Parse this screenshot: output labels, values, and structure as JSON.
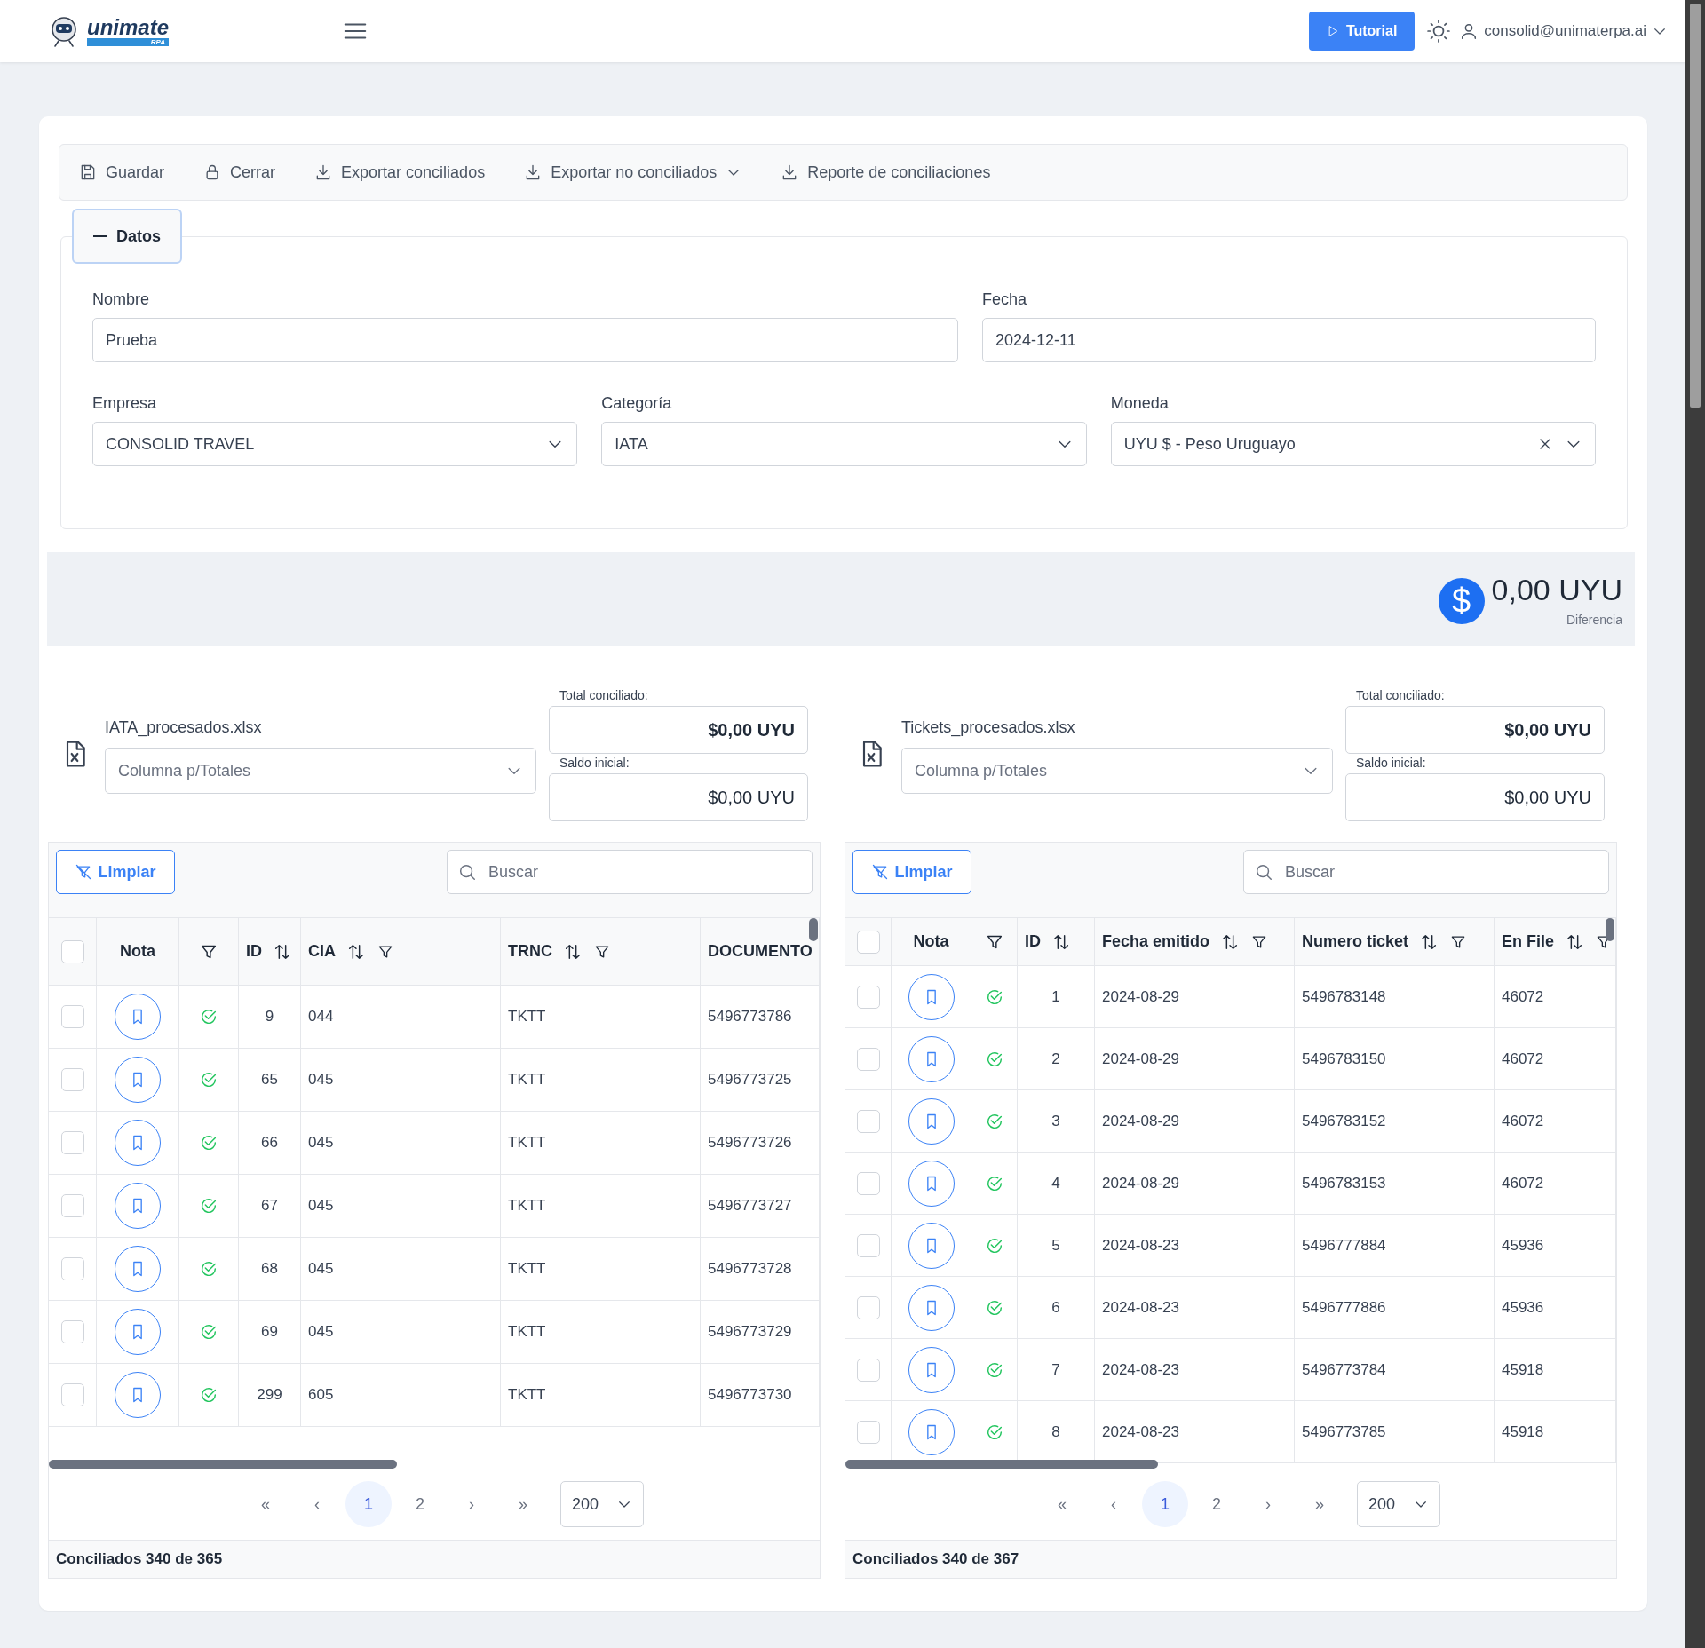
{
  "header": {
    "logo": {
      "name": "unimate",
      "tag": "RPA"
    },
    "tutorial_button": "Tutorial",
    "user": "consolid@unimaterpa.ai"
  },
  "toolbar": [
    {
      "label": "Guardar",
      "kind": "save",
      "dropdown": false
    },
    {
      "label": "Cerrar",
      "kind": "lock",
      "dropdown": false
    },
    {
      "label": "Exportar conciliados",
      "kind": "download",
      "dropdown": false
    },
    {
      "label": "Exportar no conciliados",
      "kind": "download",
      "dropdown": true
    },
    {
      "label": "Reporte de conciliaciones",
      "kind": "download",
      "dropdown": false
    }
  ],
  "datos": {
    "legend": "Datos",
    "expanded": true,
    "rows": [
      [
        {
          "label": "Nombre",
          "value": "Prueba",
          "kind": "text"
        },
        {
          "label": "Fecha",
          "value": "2024-12-11",
          "kind": "text"
        }
      ],
      [
        {
          "label": "Empresa",
          "value": "CONSOLID TRAVEL",
          "kind": "select",
          "clearable": false
        },
        {
          "label": "Categoría",
          "value": "IATA",
          "kind": "select",
          "clearable": false
        },
        {
          "label": "Moneda",
          "value": "UYU $ - Peso Uruguayo",
          "kind": "select",
          "clearable": true
        }
      ]
    ]
  },
  "difference": {
    "symbol": "$",
    "amount": "0,00 UYU",
    "label": "Diferencia"
  },
  "panels": [
    {
      "file": "IATA_procesados.xlsx",
      "column_select": {
        "placeholder": "Columna p/Totales"
      },
      "total_label": "Total conciliado:",
      "total": "$0,00 UYU",
      "saldo_label": "Saldo inicial:",
      "saldo": "$0,00 UYU",
      "clear_button": "Limpiar",
      "search": {
        "placeholder": "Buscar"
      },
      "table": {
        "columns": [
          {
            "kind": "select",
            "checked": false
          },
          {
            "kind": "label",
            "label": "Nota"
          },
          {
            "kind": "filter"
          },
          {
            "kind": "data",
            "label": "ID",
            "sortable": true,
            "filterable": false
          },
          {
            "kind": "data",
            "label": "CIA",
            "sortable": true,
            "filterable": true
          },
          {
            "kind": "data",
            "label": "TRNC",
            "sortable": true,
            "filterable": true
          },
          {
            "kind": "data",
            "label": "DOCUMENTO",
            "sortable": false,
            "filterable": false
          }
        ],
        "rows": [
          {
            "checked": false,
            "conciliado": true,
            "cells": [
              "9",
              "044",
              "TKTT",
              "5496773786"
            ]
          },
          {
            "checked": false,
            "conciliado": true,
            "cells": [
              "65",
              "045",
              "TKTT",
              "5496773725"
            ]
          },
          {
            "checked": false,
            "conciliado": true,
            "cells": [
              "66",
              "045",
              "TKTT",
              "5496773726"
            ]
          },
          {
            "checked": false,
            "conciliado": true,
            "cells": [
              "67",
              "045",
              "TKTT",
              "5496773727"
            ]
          },
          {
            "checked": false,
            "conciliado": true,
            "cells": [
              "68",
              "045",
              "TKTT",
              "5496773728"
            ]
          },
          {
            "checked": false,
            "conciliado": true,
            "cells": [
              "69",
              "045",
              "TKTT",
              "5496773729"
            ]
          },
          {
            "checked": false,
            "conciliado": true,
            "cells": [
              "299",
              "605",
              "TKTT",
              "5496773730"
            ]
          }
        ]
      },
      "pagination": {
        "first": "«",
        "prev": "‹",
        "pages": [
          {
            "label": "1",
            "selected": true
          },
          {
            "label": "2",
            "selected": false
          }
        ],
        "next": "›",
        "last": "»",
        "page_size": "200"
      },
      "footer": "Conciliados 340 de 365"
    },
    {
      "file": "Tickets_procesados.xlsx",
      "column_select": {
        "placeholder": "Columna p/Totales"
      },
      "total_label": "Total conciliado:",
      "total": "$0,00 UYU",
      "saldo_label": "Saldo inicial:",
      "saldo": "$0,00 UYU",
      "clear_button": "Limpiar",
      "search": {
        "placeholder": "Buscar"
      },
      "table": {
        "columns": [
          {
            "kind": "select",
            "checked": false
          },
          {
            "kind": "label",
            "label": "Nota"
          },
          {
            "kind": "filter"
          },
          {
            "kind": "data",
            "label": "ID",
            "sortable": true,
            "filterable": false
          },
          {
            "kind": "data",
            "label": "Fecha emitido",
            "sortable": true,
            "filterable": true
          },
          {
            "kind": "data",
            "label": "Numero ticket",
            "sortable": true,
            "filterable": true
          },
          {
            "kind": "data",
            "label": "En File",
            "sortable": true,
            "filterable": true
          }
        ],
        "rows": [
          {
            "checked": false,
            "conciliado": true,
            "cells": [
              "1",
              "2024-08-29",
              "5496783148",
              "46072"
            ]
          },
          {
            "checked": false,
            "conciliado": true,
            "cells": [
              "2",
              "2024-08-29",
              "5496783150",
              "46072"
            ]
          },
          {
            "checked": false,
            "conciliado": true,
            "cells": [
              "3",
              "2024-08-29",
              "5496783152",
              "46072"
            ]
          },
          {
            "checked": false,
            "conciliado": true,
            "cells": [
              "4",
              "2024-08-29",
              "5496783153",
              "46072"
            ]
          },
          {
            "checked": false,
            "conciliado": true,
            "cells": [
              "5",
              "2024-08-23",
              "5496777884",
              "45936"
            ]
          },
          {
            "checked": false,
            "conciliado": true,
            "cells": [
              "6",
              "2024-08-23",
              "5496777886",
              "45936"
            ]
          },
          {
            "checked": false,
            "conciliado": true,
            "cells": [
              "7",
              "2024-08-23",
              "5496773784",
              "45918"
            ]
          },
          {
            "checked": false,
            "conciliado": true,
            "cells": [
              "8",
              "2024-08-23",
              "5496773785",
              "45918"
            ]
          }
        ]
      },
      "pagination": {
        "first": "«",
        "prev": "‹",
        "pages": [
          {
            "label": "1",
            "selected": true
          },
          {
            "label": "2",
            "selected": false
          }
        ],
        "next": "›",
        "last": "»",
        "page_size": "200"
      },
      "footer": "Conciliados 340 de 367"
    }
  ]
}
